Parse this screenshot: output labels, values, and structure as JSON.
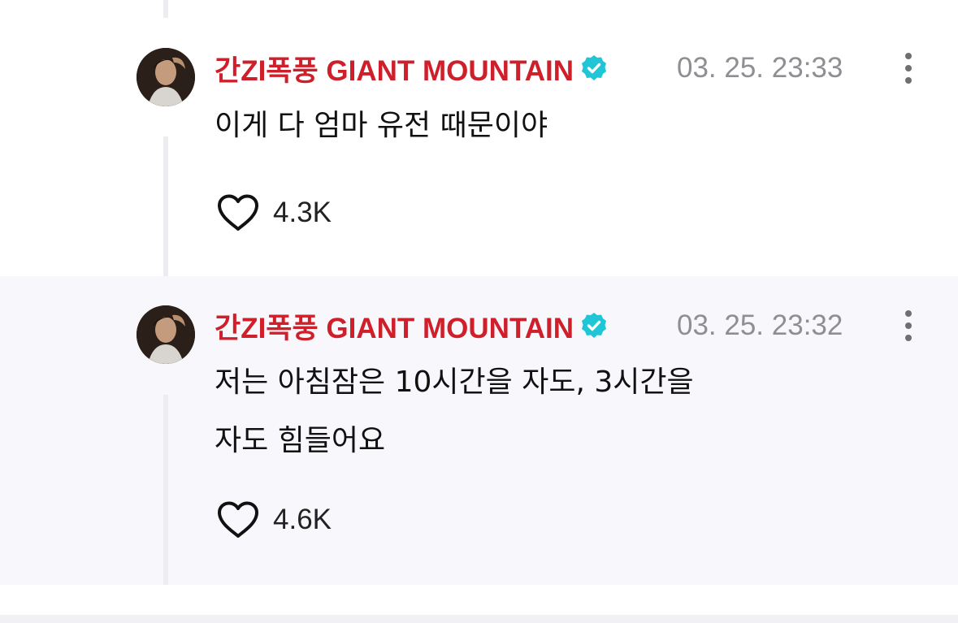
{
  "comments": [
    {
      "author": "간ZI폭풍 GIANT MOUNTAIN",
      "verified": true,
      "timestamp": "03. 25. 23:33",
      "text": "이게 다 엄마 유전 때문이야",
      "likes": "4.3K"
    },
    {
      "author": "간ZI폭풍 GIANT MOUNTAIN",
      "verified": true,
      "timestamp": "03. 25. 23:32",
      "text_line1": "저는 아침잠은 10시간을 자도, 3시간을",
      "text_line2": "자도 힘들어요",
      "likes": "4.6K"
    }
  ],
  "colors": {
    "author": "#cf1f2a",
    "verified_badge": "#20c6d6",
    "timestamp": "#8e8e93",
    "highlight_bg": "#f8f8fc",
    "thread_line": "#ececf1"
  },
  "icons": {
    "verified": "verified-badge-icon",
    "like": "heart-icon",
    "more": "more-vertical-icon"
  }
}
